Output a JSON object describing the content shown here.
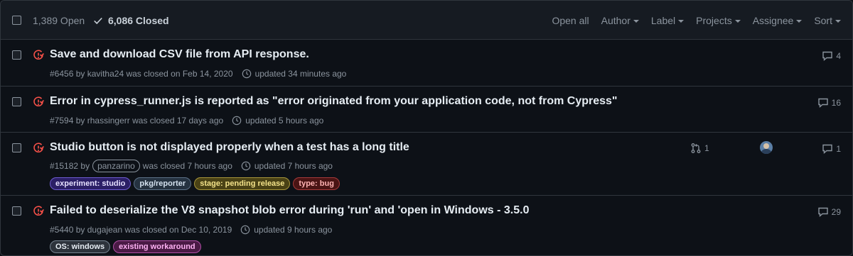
{
  "header": {
    "open_count": "1,389 Open",
    "closed_count": "6,086 Closed",
    "filters": [
      "Open all",
      "Author",
      "Label",
      "Projects",
      "Assignee",
      "Sort"
    ]
  },
  "issues": [
    {
      "title": "Save and download CSV file from API response.",
      "number": "#6456",
      "by": "by",
      "author": "kavitha24",
      "closed_text": "was closed on Feb 14, 2020",
      "updated": "updated 34 minutes ago",
      "comments": "4",
      "labels": []
    },
    {
      "title": "Error in cypress_runner.js is reported as \"error originated from your application code, not from Cypress\"",
      "number": "#7594",
      "by": "by",
      "author": "rhassingerr",
      "closed_text": "was closed 17 days ago",
      "updated": "updated 5 hours ago",
      "comments": "16",
      "labels": []
    },
    {
      "title": "Studio button is not displayed properly when a test has a long title",
      "number": "#15182",
      "by": "by",
      "author": "panzarino",
      "closed_text": "was closed 7 hours ago",
      "updated": "updated 7 hours ago",
      "comments": "1",
      "linked_prs": "1",
      "labels": [
        {
          "text": "experiment: studio",
          "bg": "#2b1f66",
          "border": "#6e5cd0",
          "color": "#e6e0ff"
        },
        {
          "text": "pkg/reporter",
          "bg": "#253240",
          "border": "#5d7288",
          "color": "#d4e1ee"
        },
        {
          "text": "stage: pending release",
          "bg": "#4a4215",
          "border": "#a8963a",
          "color": "#f4e38a"
        },
        {
          "text": "type: bug",
          "bg": "#4a1414",
          "border": "#a63a3a",
          "color": "#ffb3b3"
        }
      ]
    },
    {
      "title": "Failed to deserialize the V8 snapshot blob error during 'run' and 'open in Windows - 3.5.0",
      "number": "#5440",
      "by": "by",
      "author": "dugajean",
      "closed_text": "was closed on Dec 10, 2019",
      "updated": "updated 9 hours ago",
      "comments": "29",
      "labels": [
        {
          "text": "OS: windows",
          "bg": "#2d333b",
          "border": "#768390",
          "color": "#e6edf3"
        },
        {
          "text": "existing workaround",
          "bg": "#4a1a45",
          "border": "#b04fa6",
          "color": "#ffb3f4"
        }
      ]
    }
  ],
  "colors": {
    "closed_issue_icon": "#f85149",
    "accent_text": "#e6edf3"
  }
}
